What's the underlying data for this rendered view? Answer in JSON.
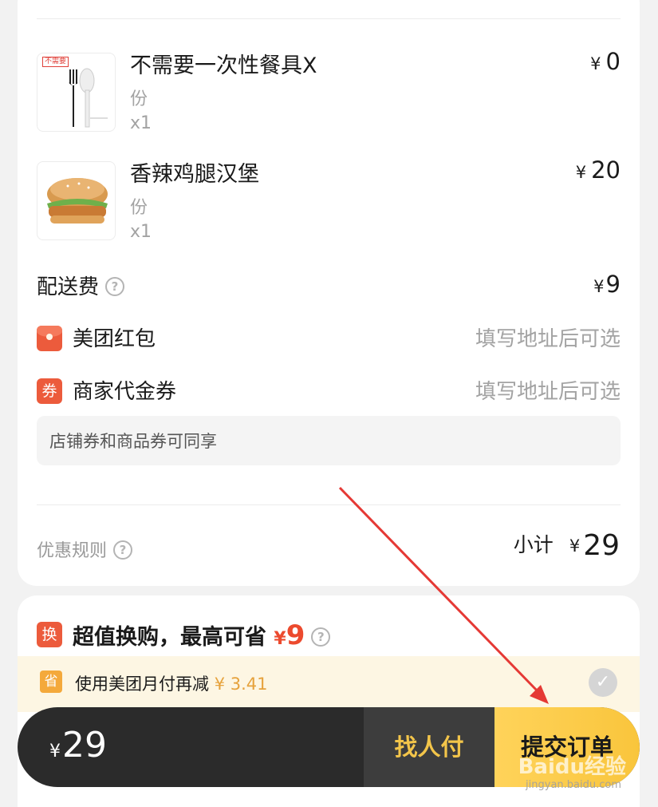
{
  "items": [
    {
      "name": "不需要一次性餐具X",
      "unit": "份",
      "qty": "x1",
      "yen": "¥",
      "price": "0",
      "tag": "不需要"
    },
    {
      "name": "香辣鸡腿汉堡",
      "unit": "份",
      "qty": "x1",
      "yen": "¥",
      "price": "20"
    }
  ],
  "delivery": {
    "label": "配送费",
    "help": "?",
    "yen": "¥",
    "value": "9"
  },
  "redpacket": {
    "label": "美团红包",
    "status": "填写地址后可选"
  },
  "voucher": {
    "label": "商家代金券",
    "icon_text": "券",
    "status": "填写地址后可选"
  },
  "share_note": "店铺券和商品券可同享",
  "rules": {
    "label": "优惠规则",
    "help": "?"
  },
  "subtotal": {
    "label": "小计",
    "yen": "¥",
    "value": "29"
  },
  "promo": {
    "icon_text": "换",
    "title": "超值换购，最高可省",
    "yen": "¥",
    "amount": "9",
    "help": "?"
  },
  "monthly_pay": {
    "icon_text": "省",
    "text": "使用美团月付再减",
    "amount": "¥ 3.41",
    "check": "✓"
  },
  "bottom_bar": {
    "yen": "¥",
    "total": "29",
    "find_pay": "找人付",
    "submit": "提交订单"
  },
  "watermark": {
    "brand": "Baidu经验",
    "url": "jingyan.baidu.com"
  },
  "colors": {
    "accent_red": "#ec5b3c",
    "submit_yellow": "#ffd35a",
    "find_pay_text": "#f3c54a",
    "arrow": "#e53935"
  }
}
